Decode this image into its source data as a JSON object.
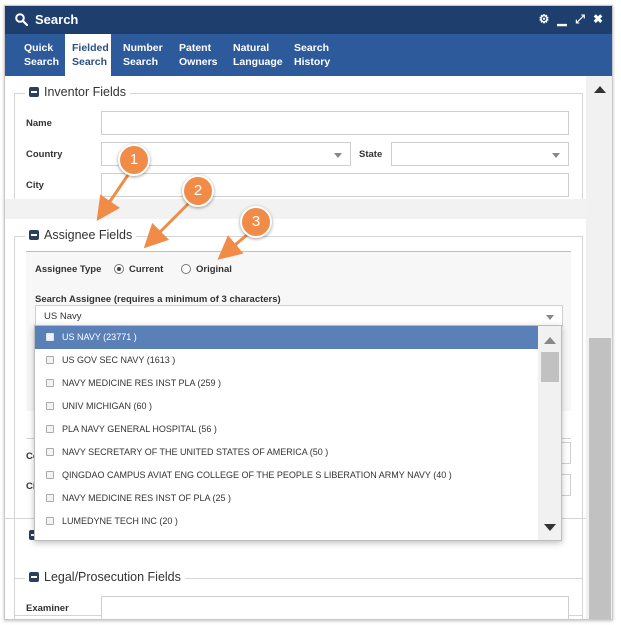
{
  "window": {
    "title": "Search",
    "controls": [
      {
        "name": "settings-icon",
        "glyph": "⚙"
      },
      {
        "name": "minimize-icon",
        "glyph": "▁"
      },
      {
        "name": "expand-icon",
        "glyph": "⤢"
      },
      {
        "name": "close-icon",
        "glyph": "✖"
      }
    ]
  },
  "tabs": [
    {
      "line1": "Quick",
      "line2": "Search",
      "active": false
    },
    {
      "line1": "Fielded",
      "line2": "Search",
      "active": true
    },
    {
      "line1": "Number",
      "line2": "Search",
      "active": false
    },
    {
      "line1": "Patent",
      "line2": "Owners",
      "active": false
    },
    {
      "line1": "Natural",
      "line2": "Language",
      "active": false
    },
    {
      "line1": "Search",
      "line2": "History",
      "active": false
    }
  ],
  "inventor": {
    "legend": "Inventor Fields",
    "name_label": "Name",
    "country_label": "Country",
    "state_label": "State",
    "city_label": "City"
  },
  "assignee": {
    "legend": "Assignee Fields",
    "type_label": "Assignee Type",
    "option_current": "Current",
    "option_original": "Original",
    "selected_type": "Current",
    "search_label": "Search Assignee (requires a minimum of 3 characters)",
    "search_value": "US Navy",
    "hidden_label_co": "Co",
    "hidden_label_ci": "Ci"
  },
  "dropdown_options": [
    {
      "label": "US NAVY (23771 )",
      "selected": true
    },
    {
      "label": "US GOV SEC NAVY (1613 )",
      "selected": false
    },
    {
      "label": "NAVY MEDICINE RES INST PLA (259 )",
      "selected": false
    },
    {
      "label": "UNIV MICHIGAN (60 )",
      "selected": false
    },
    {
      "label": "PLA NAVY GENERAL HOSPITAL (56 )",
      "selected": false
    },
    {
      "label": "NAVY SECRETARY OF THE UNITED STATES OF AMERICA (50 )",
      "selected": false
    },
    {
      "label": "QINGDAO CAMPUS AVIAT ENG COLLEGE OF THE PEOPLE S LIBERATION ARMY NAVY (40 )",
      "selected": false
    },
    {
      "label": "NAVY MEDICINE RES INST OF PLA (25 )",
      "selected": false
    },
    {
      "label": "LUMEDYNE TECH INC (20 )",
      "selected": false
    }
  ],
  "legal": {
    "legend": "Legal/Prosecution Fields",
    "examiner_label": "Examiner"
  },
  "callouts": [
    "1",
    "2",
    "3"
  ],
  "colors": {
    "titlebar": "#1e3f6e",
    "tabbar": "#2d5a9a",
    "selected_option": "#5b80b8",
    "callout": "#f08c48"
  }
}
